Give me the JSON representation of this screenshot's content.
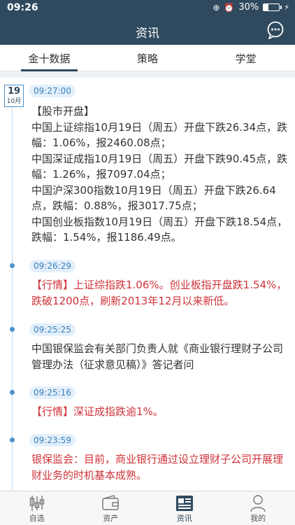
{
  "status_bar": {
    "time": "09:26",
    "battery": "30%"
  },
  "header": {
    "title": "资讯"
  },
  "tabs": [
    {
      "label": "金十数据"
    },
    {
      "label": "策略"
    },
    {
      "label": "学堂"
    }
  ],
  "date_badge": {
    "day": "19",
    "month": "10月"
  },
  "news": [
    {
      "time": "09:27:00",
      "lines": [
        "【股市开盘】",
        "中国上证综指10月19日（周五）开盘下跌26.34点，跌",
        "幅：1.06%，报2460.08点；",
        "中国深证成指10月19日（周五）开盘下跌90.45点，跌",
        "幅：1.26%，报7097.04点；",
        "中国沪深300指数10月19日（周五）开盘下跌26.64",
        "点，跌幅：0.88%，报3017.75点；",
        "中国创业板指数10月19日（周五）开盘下跌18.54点，",
        "跌幅：1.54%，报1186.49点。"
      ]
    },
    {
      "time": "09:26:29",
      "lines": [
        "【行情】上证综指跌1.06%。创业板指开盘跌1.54%，",
        "跌破1200点，刷新2013年12月以来新低。"
      ]
    },
    {
      "time": "09:25:25",
      "lines": [
        "中国银保监会有关部门负责人就《商业银行理财子公司",
        "管理办法（征求意见稿）》答记者问"
      ]
    },
    {
      "time": "09:25:16",
      "lines": [
        "【行情】深证成指跌逾1%。"
      ]
    },
    {
      "time": "09:23:59",
      "lines": [
        "银保监会：目前，商业银行通过设立理财子公司开展理",
        "财业务的时机基本成熟。"
      ]
    }
  ],
  "bottom_nav": [
    {
      "label": "自选"
    },
    {
      "label": "资产"
    },
    {
      "label": "资讯"
    },
    {
      "label": "我的"
    }
  ]
}
